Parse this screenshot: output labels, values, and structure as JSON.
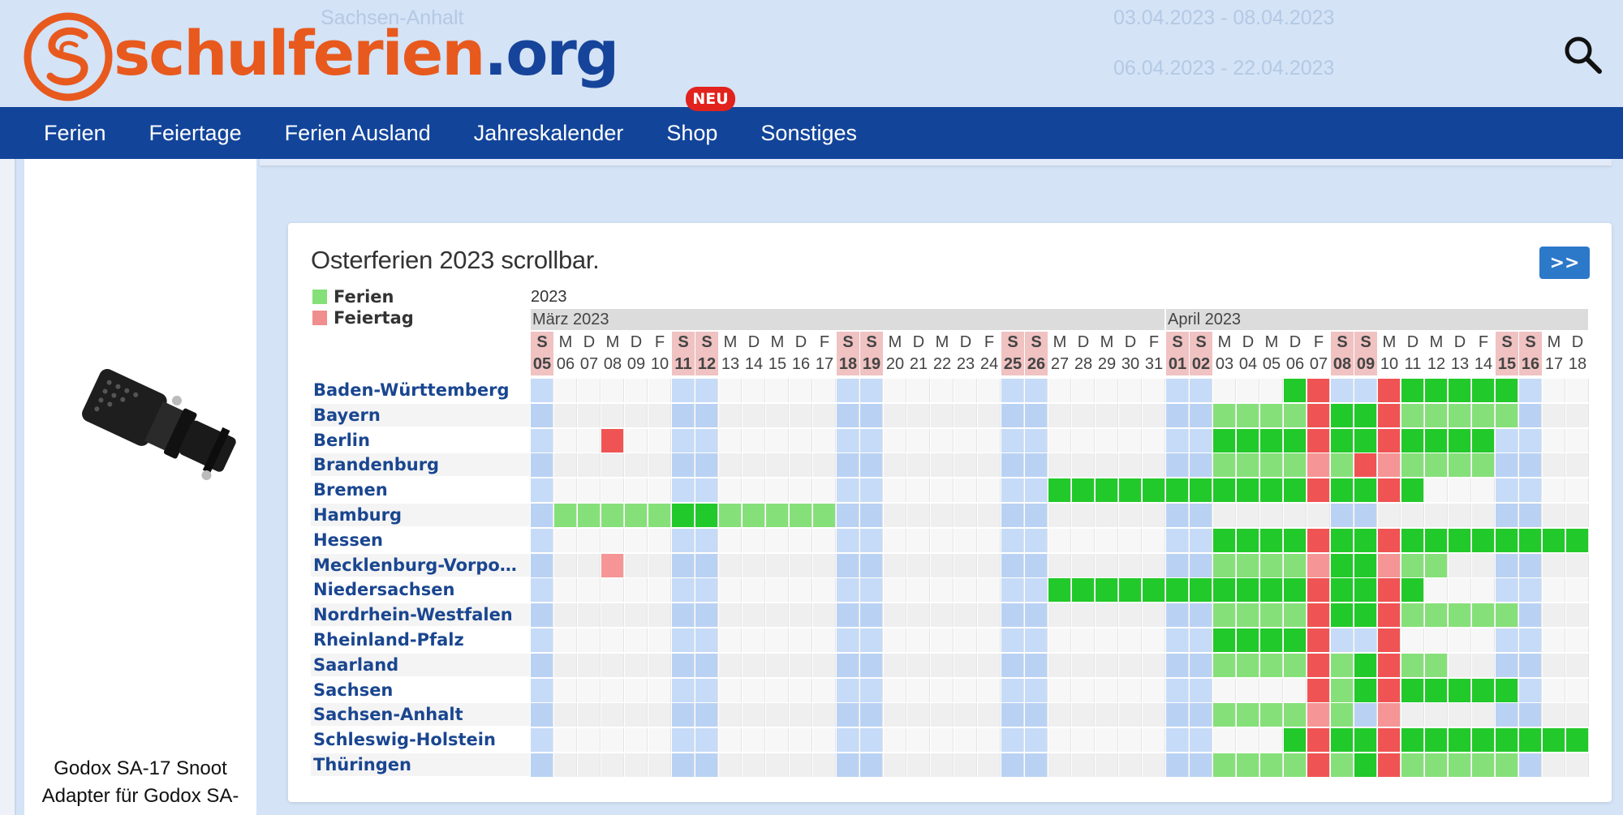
{
  "ghost_text": [
    {
      "text": "Sachsen-Anhalt"
    },
    {
      "text": "03.04.2023 - 08.04.2023"
    },
    {
      "text": "06.04.2023 - 22.04.2023"
    }
  ],
  "header": {
    "logo_text_a": "schulferien",
    "logo_text_b": ".org",
    "search_icon": "search-icon"
  },
  "nav": {
    "items": [
      "Ferien",
      "Feiertage",
      "Ferien Ausland",
      "Jahreskalender",
      "Shop",
      "Sonstiges"
    ],
    "shop_badge": "NEU"
  },
  "sidebar": {
    "product_lines": [
      "Godox SA-17 Snoot",
      "Adapter für Godox SA-"
    ]
  },
  "card": {
    "title": "Osterferien 2023 scrollbar.",
    "next_button": ">>",
    "legend": [
      {
        "label": "Ferien",
        "color": "#86e079"
      },
      {
        "label": "Feiertag",
        "color": "#f08d8d"
      }
    ],
    "year": "2023",
    "months": [
      {
        "label": "März 2023",
        "days": 27
      },
      {
        "label": "April 2023",
        "days": 18
      }
    ],
    "day_letters": [
      "S",
      "M",
      "D",
      "M",
      "D",
      "F",
      "S",
      "S",
      "M",
      "D",
      "M",
      "D",
      "F",
      "S",
      "S",
      "M",
      "D",
      "M",
      "D",
      "F",
      "S",
      "S",
      "M",
      "D",
      "M",
      "D",
      "F",
      "S",
      "S",
      "M",
      "D",
      "M",
      "D",
      "F",
      "S",
      "S",
      "M",
      "D",
      "M",
      "D",
      "F",
      "S",
      "S",
      "M",
      "D"
    ],
    "day_numbers": [
      "05",
      "06",
      "07",
      "08",
      "09",
      "10",
      "11",
      "12",
      "13",
      "14",
      "15",
      "16",
      "17",
      "18",
      "19",
      "20",
      "21",
      "22",
      "23",
      "24",
      "25",
      "26",
      "27",
      "28",
      "29",
      "30",
      "31",
      "01",
      "02",
      "03",
      "04",
      "05",
      "06",
      "07",
      "08",
      "09",
      "10",
      "11",
      "12",
      "13",
      "14",
      "15",
      "16",
      "17",
      "18"
    ],
    "weekend_indices": [
      0,
      6,
      7,
      13,
      14,
      20,
      21,
      27,
      28,
      34,
      35,
      41,
      42
    ],
    "states": [
      "Baden-Württemberg",
      "Bayern",
      "Berlin",
      "Brandenburg",
      "Bremen",
      "Hamburg",
      "Hessen",
      "Mecklenburg-Vorpo…",
      "Niedersachsen",
      "Nordrhein-Westfalen",
      "Rheinland-Pfalz",
      "Saarland",
      "Sachsen",
      "Sachsen-Anhalt",
      "Schleswig-Holstein",
      "Thüringen"
    ]
  },
  "colors": {
    "nav_bg": "#12449a",
    "holiday_green": "#22c92a",
    "holiday_light_green": "#86e079",
    "feiertag_red": "#f05353",
    "feiertag_light_red": "#f59595",
    "weekend_blue": "#c2d8f7"
  }
}
